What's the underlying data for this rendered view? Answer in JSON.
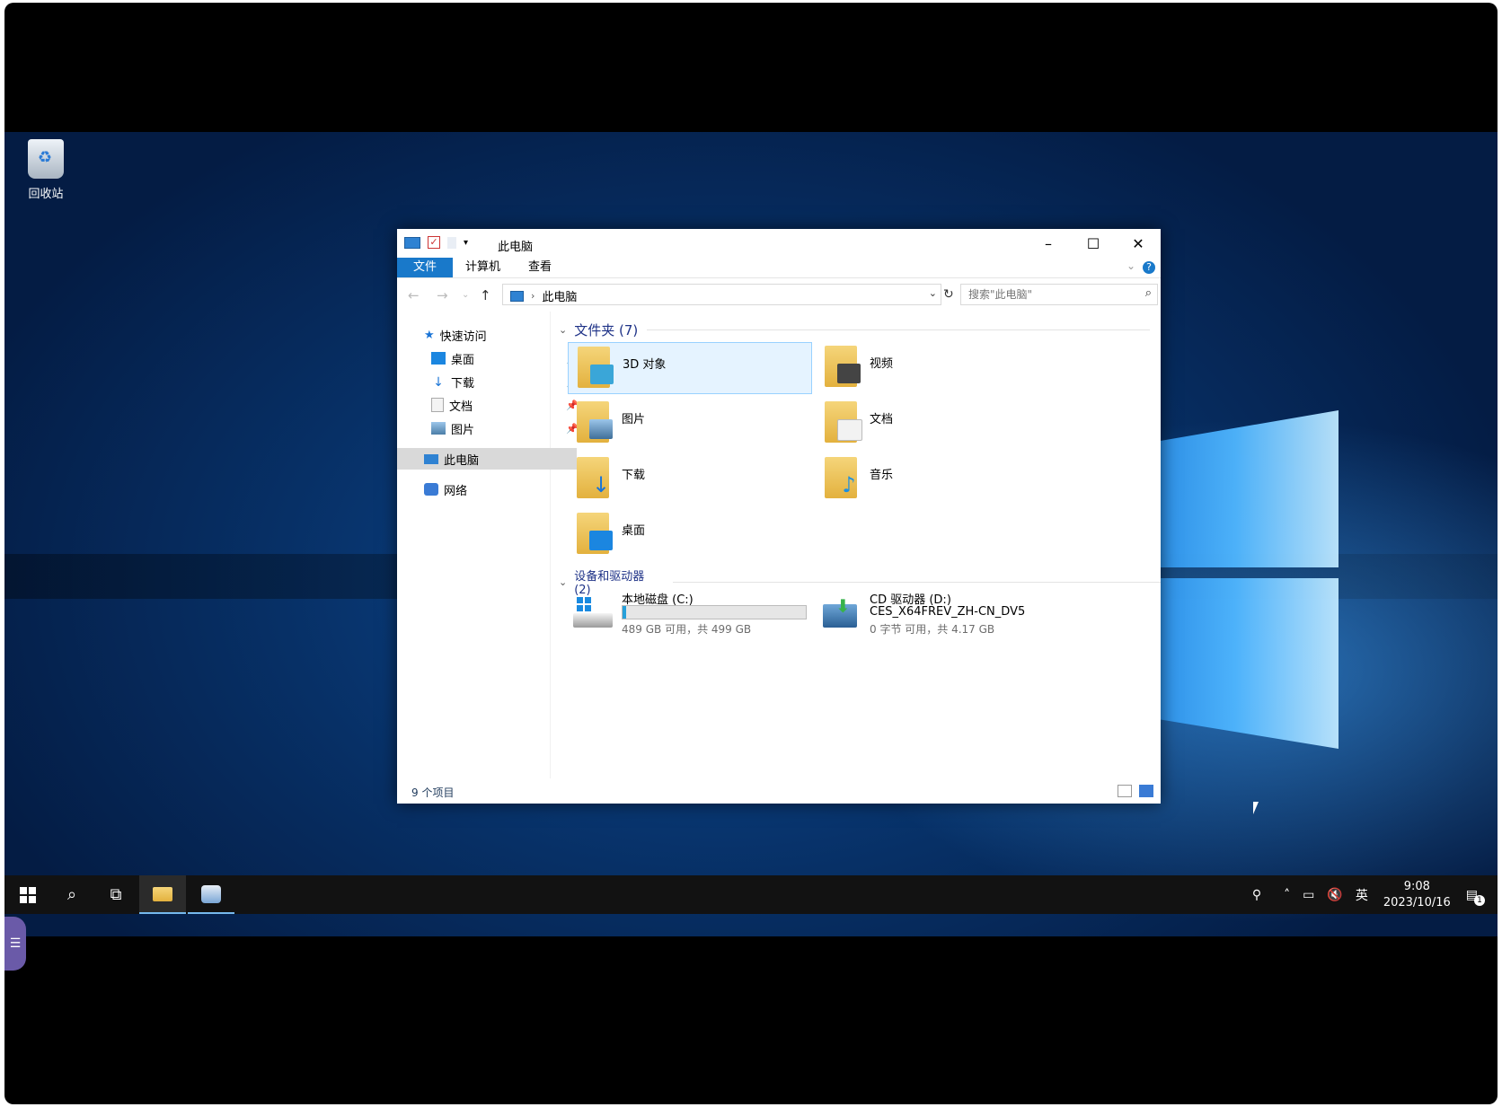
{
  "desktop": {
    "recycle_bin_label": "回收站"
  },
  "window": {
    "title": "此电脑",
    "ribbon": {
      "tabs": [
        "文件",
        "计算机",
        "查看"
      ],
      "help": "?"
    },
    "address": {
      "location": "此电脑",
      "search_placeholder": "搜索\"此电脑\""
    },
    "nav": {
      "quick_access": "快速访问",
      "quick_items": [
        "桌面",
        "下载",
        "文档",
        "图片"
      ],
      "this_pc": "此电脑",
      "network": "网络"
    },
    "groups": {
      "folders_header": "文件夹 (7)",
      "devices_header": "设备和驱动器 (2)"
    },
    "folders": [
      {
        "name": "3D 对象",
        "badge": "#3aa6d8"
      },
      {
        "name": "视频",
        "badge": "#444444"
      },
      {
        "name": "图片",
        "badge": "#6aa4d8"
      },
      {
        "name": "文档",
        "badge": "#f2f2f2"
      },
      {
        "name": "下载",
        "badge": "#1a74d6"
      },
      {
        "name": "音乐",
        "badge": "#1c8fe0"
      },
      {
        "name": "桌面",
        "badge": "#1b86e0"
      }
    ],
    "drives": [
      {
        "label": "本地磁盘 (C:)",
        "capacity": "489 GB 可用，共 499 GB",
        "used_fraction": 0.02
      },
      {
        "label": "CD 驱动器 (D:)",
        "volume": "CES_X64FREV_ZH-CN_DV5",
        "capacity": "0 字节 可用，共 4.17 GB"
      }
    ],
    "status": {
      "item_count": "9 个项目"
    }
  },
  "taskbar": {
    "ime": "英",
    "time": "9:08",
    "date": "2023/10/16",
    "notification_count": "1"
  },
  "colors": {
    "accent": "#1979ca",
    "selection": "#e5f3ff",
    "taskbar": "#121212"
  }
}
